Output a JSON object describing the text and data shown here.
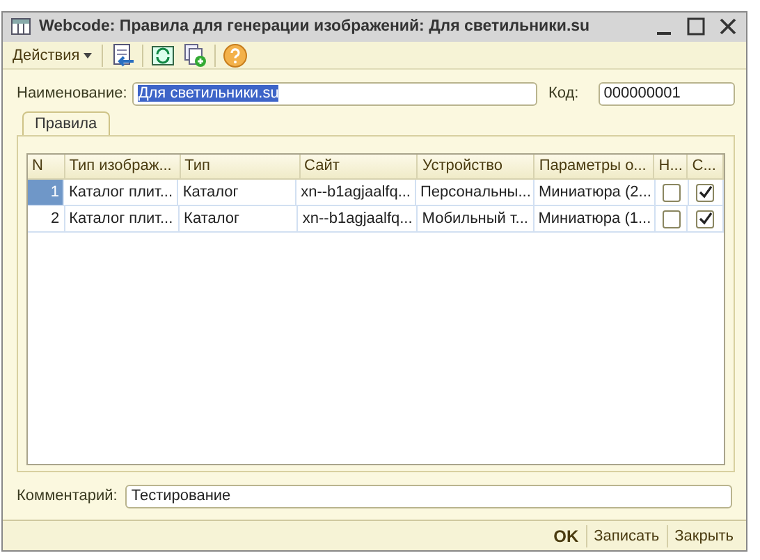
{
  "window": {
    "title": "Webcode: Правила для генерации изображений: Для светильники.su"
  },
  "toolbar": {
    "actions_menu": "Действия"
  },
  "fields": {
    "name_label": "Наименование:",
    "name_value": "Для светильники.su",
    "code_label": "Код:",
    "code_value": "000000001",
    "comment_label": "Комментарий:",
    "comment_value": "Тестирование"
  },
  "tabs": [
    {
      "label": "Правила",
      "selected": true
    }
  ],
  "table": {
    "columns": [
      "N",
      "Тип изображ...",
      "Тип",
      "Сайт",
      "Устройство",
      "Параметры о...",
      "Н...",
      "С..."
    ],
    "rows": [
      {
        "n": "1",
        "image_type": "Каталог плит...",
        "type": "Каталог",
        "site": "xn--b1agjaalfq...",
        "device": "Персональны...",
        "params": "Миниатюра (2...",
        "column_7": false,
        "column_8": true,
        "selected": true
      },
      {
        "n": "2",
        "image_type": "Каталог плит...",
        "type": "Каталог",
        "site": "xn--b1agjaalfq...",
        "device": "Мобильный т...",
        "params": "Миниатюра (1...",
        "column_7": false,
        "column_8": true,
        "selected": false
      }
    ]
  },
  "buttons": [
    {
      "label": "OK",
      "kind": "default"
    },
    {
      "label": "Записать",
      "kind": "plain"
    },
    {
      "label": "Закрыть",
      "kind": "plain"
    }
  ]
}
